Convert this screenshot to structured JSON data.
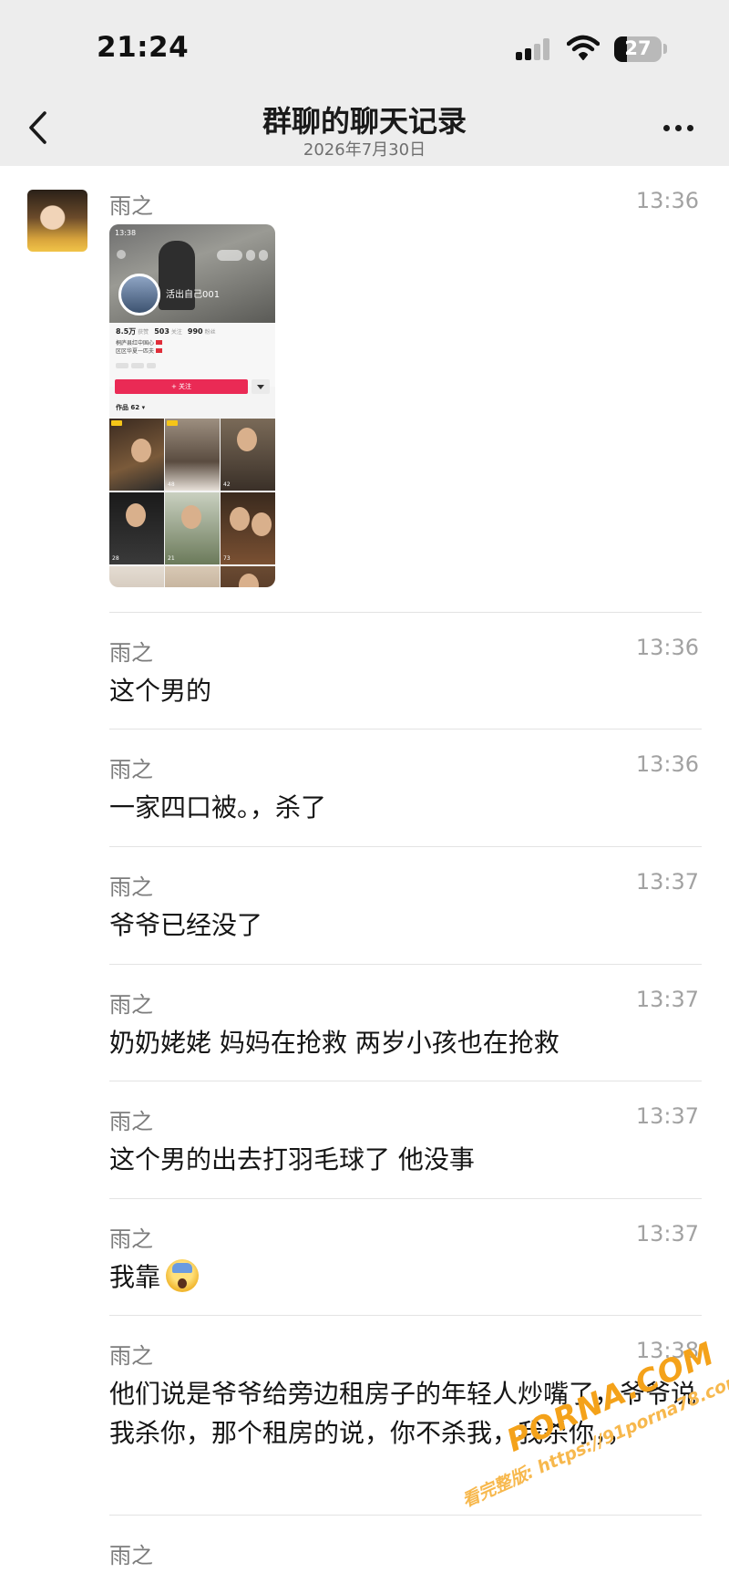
{
  "status_bar": {
    "time": "21:24",
    "battery": "27",
    "battery_level": 0.27
  },
  "nav": {
    "title": "群聊的聊天记录",
    "subtitle": "2026年7月30日"
  },
  "thumbnail": {
    "status_time": "13:38",
    "profile_name": "活出自己001",
    "stat_1_value": "8.5万",
    "stat_1_label": "获赞",
    "stat_2_value": "503",
    "stat_2_label": "关注",
    "stat_3_value": "990",
    "stat_3_label": "粉丝",
    "bio_line_1": "桐庐县红中国心",
    "bio_line_2": "区区华夏一匹夫",
    "follow_label": "+ 关注",
    "works_label": "作品 62 ▾",
    "tile_likes": [
      "",
      "48",
      "42",
      "28",
      "21",
      "73",
      "",
      "",
      ""
    ]
  },
  "messages": [
    {
      "sender": "雨之",
      "time": "13:36",
      "text": ""
    },
    {
      "sender": "雨之",
      "time": "13:36",
      "text": "这个男的"
    },
    {
      "sender": "雨之",
      "time": "13:36",
      "text": "一家四口被。，杀了"
    },
    {
      "sender": "雨之",
      "time": "13:37",
      "text": "爷爷已经没了"
    },
    {
      "sender": "雨之",
      "time": "13:37",
      "text": "奶奶姥姥 妈妈在抢救 两岁小孩也在抢救"
    },
    {
      "sender": "雨之",
      "time": "13:37",
      "text": "这个男的出去打羽毛球了 他没事"
    },
    {
      "sender": "雨之",
      "time": "13:37",
      "text": "我靠"
    },
    {
      "sender": "雨之",
      "time": "13:38",
      "text": "他们说是爷爷给旁边租房子的年轻人炒嘴了，爷爷说我杀你，那个租房的说，你不杀我，我杀你，，"
    },
    {
      "sender": "雨之",
      "time": "",
      "text": ""
    }
  ],
  "watermark": {
    "brand": "PORNA.COM",
    "url": "看完整版: https://91porna78.com"
  },
  "icons": [
    "signal-icon",
    "wifi-icon",
    "battery-icon",
    "back-icon",
    "more-icon",
    "scream-emoji-icon"
  ],
  "colors": {
    "header_bg": "#ededed",
    "follow_button": "#ea2a55",
    "watermark": "#f4a21a"
  }
}
